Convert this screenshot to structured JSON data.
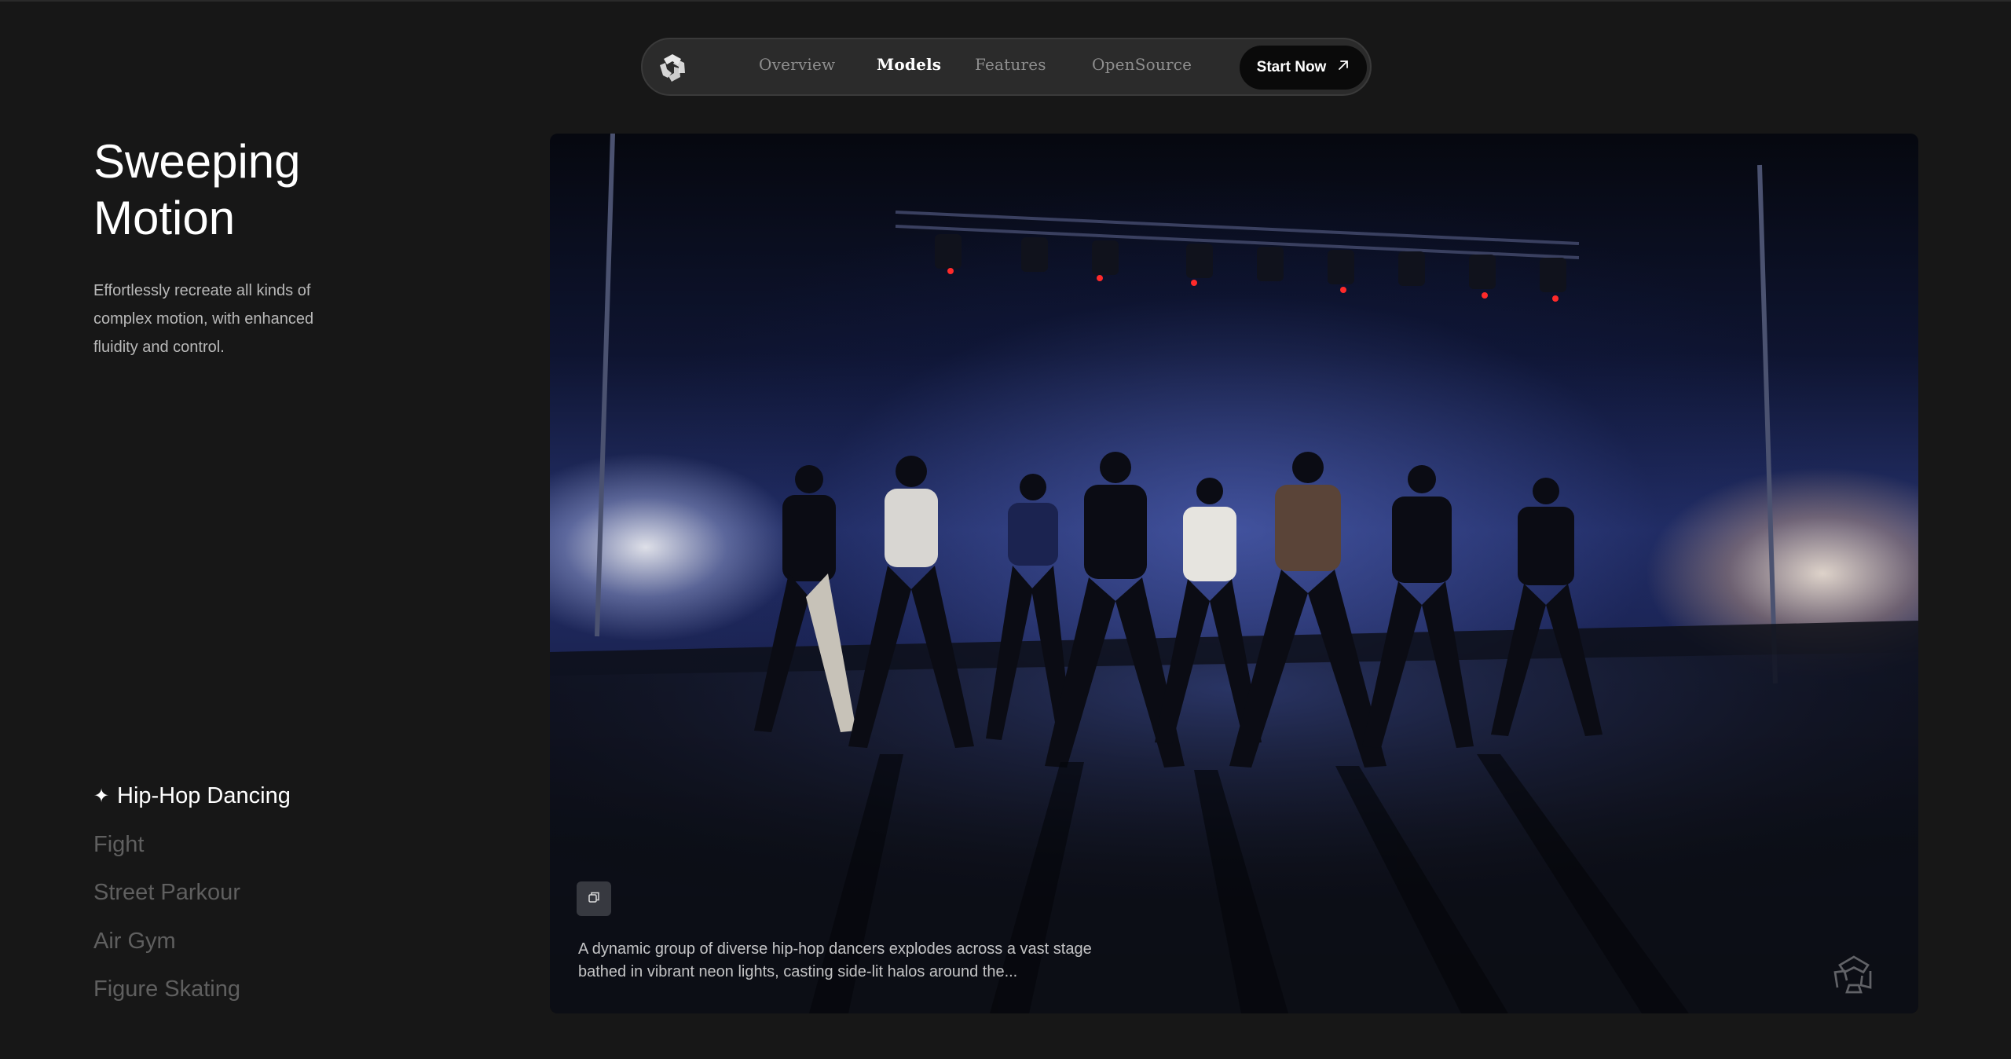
{
  "nav": {
    "logo_icon": "brand-logo-icon",
    "links": [
      {
        "label": "Overview",
        "active": false
      },
      {
        "label": "Models",
        "active": true
      },
      {
        "label": "Features",
        "active": false
      },
      {
        "label": "OpenSource",
        "active": false
      }
    ],
    "cta": {
      "label": "Start Now",
      "icon": "arrow-up-right-icon"
    }
  },
  "hero": {
    "title_line1": "Sweeping",
    "title_line2": "Motion",
    "description": "Effortlessly recreate all kinds of complex motion, with enhanced fluidity and control."
  },
  "categories": [
    {
      "label": "Hip-Hop Dancing",
      "active": true,
      "icon": "sparkle-icon"
    },
    {
      "label": "Fight",
      "active": false
    },
    {
      "label": "Street Parkour",
      "active": false
    },
    {
      "label": "Air Gym",
      "active": false
    },
    {
      "label": "Figure Skating",
      "active": false
    }
  ],
  "video": {
    "caption": "A dynamic group of diverse hip-hop dancers explodes across a vast stage bathed in vibrant neon lights, casting side-lit halos around the...",
    "copy_icon": "copy-icon",
    "watermark_icon": "watermark-logo-icon"
  },
  "colors": {
    "background": "#171717",
    "nav_background": "#2b2b2b",
    "cta_background": "#0a0a0a",
    "text_primary": "#ffffff",
    "text_muted": "#5f5f5f"
  }
}
